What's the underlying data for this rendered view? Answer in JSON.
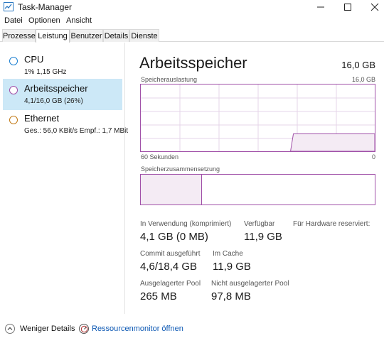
{
  "window": {
    "title": "Task-Manager"
  },
  "menu": [
    "Datei",
    "Optionen",
    "Ansicht"
  ],
  "tabs": [
    "Prozesse",
    "Leistung",
    "Benutzer",
    "Details",
    "Dienste"
  ],
  "active_tab": "Leistung",
  "resources": [
    {
      "name": "CPU",
      "detail": "1% 1,15 GHz",
      "color": "#1c7fd1"
    },
    {
      "name": "Arbeitsspeicher",
      "detail": "4,1/16,0 GB (26%)",
      "color": "#a050a8",
      "selected": true
    },
    {
      "name": "Ethernet",
      "detail": "Ges.: 56,0 KBit/s Empf.: 1,7 MBit",
      "color": "#c27a17"
    }
  ],
  "main": {
    "title": "Arbeitsspeicher",
    "total": "16,0 GB",
    "usage_label": "Speicherauslastung",
    "usage_max": "16,0 GB",
    "time_label": "60 Sekunden",
    "time_end": "0",
    "composition_label": "Speicherzusammensetzung",
    "usage_fraction": 0.26,
    "composition_used_fraction": 0.26,
    "accent_color": "#a050a8"
  },
  "stats": {
    "in_use": {
      "label": "In Verwendung (komprimiert)",
      "value": "4,1 GB (0 MB)"
    },
    "available": {
      "label": "Verfügbar",
      "value": "11,9 GB"
    },
    "reserved": {
      "label": "Für Hardware reserviert:",
      "value": ""
    },
    "committed": {
      "label": "Commit ausgeführt",
      "value": "4,6/18,4 GB"
    },
    "cached": {
      "label": "Im Cache",
      "value": "11,9 GB"
    },
    "paged_pool": {
      "label": "Ausgelagerter Pool",
      "value": "265 MB"
    },
    "nonpaged_pool": {
      "label": "Nicht ausgelagerter Pool",
      "value": "97,8 MB"
    }
  },
  "footer": {
    "fewer_details": "Weniger Details",
    "resource_monitor": "Ressourcenmonitor öffnen"
  }
}
